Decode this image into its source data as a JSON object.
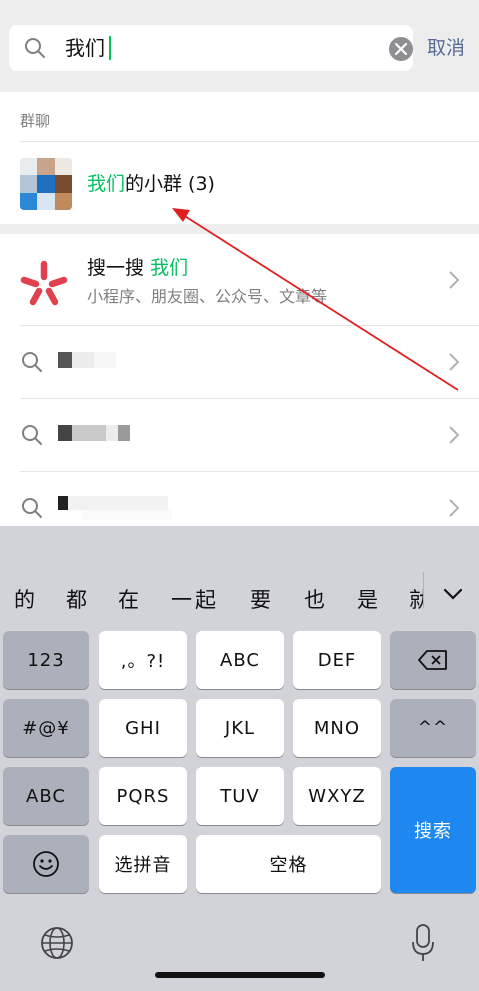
{
  "search": {
    "query": "我们",
    "cancel_label": "取消"
  },
  "group_section": {
    "title": "群聊",
    "group": {
      "name_highlight": "我们",
      "name_rest": "的小群 (3)"
    }
  },
  "souyisou": {
    "title_prefix": "搜一搜",
    "title_highlight": "我们",
    "subtitle": "小程序、朋友圈、公众号、文章等"
  },
  "keyboard": {
    "candidates": [
      "的",
      "都",
      "在",
      "一起",
      "要",
      "也",
      "是",
      "就"
    ],
    "rows": {
      "row1": [
        "123",
        ",。?!",
        "ABC",
        "DEF"
      ],
      "row2": [
        "#@¥",
        "GHI",
        "JKL",
        "MNO",
        "^^"
      ],
      "row3": [
        "ABC",
        "PQRS",
        "TUV",
        "WXYZ"
      ],
      "row4": [
        "选拼音",
        "空格"
      ]
    },
    "search_key": "搜索"
  },
  "icons": {
    "search": "search-icon",
    "clear": "clear-icon",
    "chevron": "chevron-right-icon",
    "backspace": "backspace-icon",
    "emoji": "emoji-icon",
    "globe": "globe-icon",
    "microphone": "microphone-icon",
    "collapse": "chevron-down-icon"
  },
  "colors": {
    "highlight": "#07c160",
    "link": "#576b95",
    "search_key": "#1e87f0",
    "annotation": "#e02020"
  }
}
